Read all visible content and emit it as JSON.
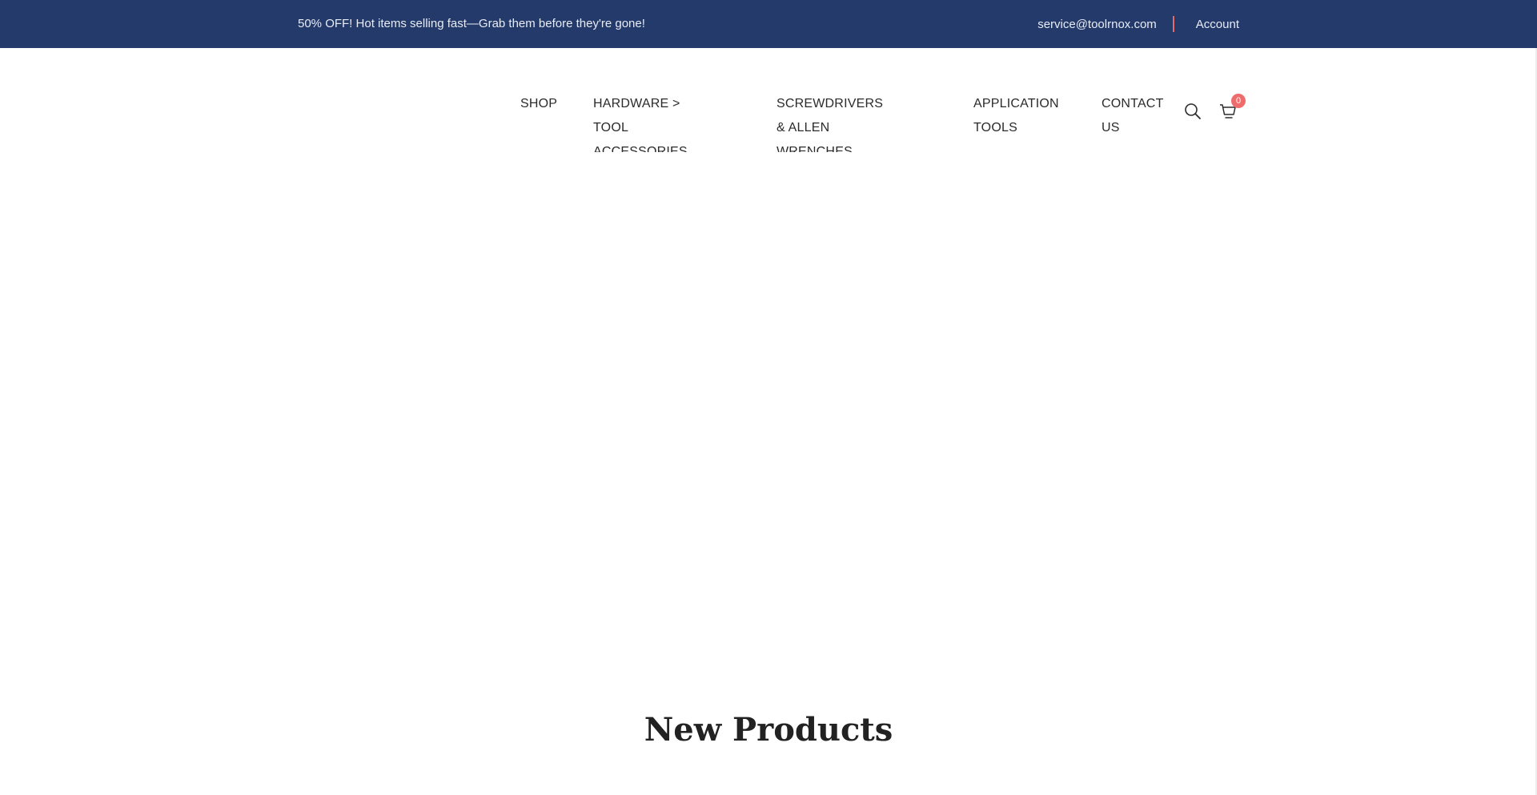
{
  "topbar": {
    "promo": "50% OFF! Hot items selling fast—Grab them before they're gone!",
    "email": "service@toolrnox.com",
    "account": "Account",
    "background": "#243a6a",
    "separator_color": "#e56a6a"
  },
  "nav": {
    "items": [
      {
        "line1": "SHOP",
        "line2": ""
      },
      {
        "line1": "HARDWARE > TOOL",
        "line2": "ACCESSORIES"
      },
      {
        "line1": "SCREWDRIVERS & ALLEN",
        "line2": "WRENCHES"
      },
      {
        "line1": "APPLICATION",
        "line2": "TOOLS"
      },
      {
        "line1": "CONTACT",
        "line2": "US"
      }
    ],
    "search_icon": "search-icon",
    "cart_icon": "cart-icon",
    "cart_count": "0",
    "badge_color": "#f06b6b"
  },
  "main": {
    "section_title": "New Products"
  }
}
